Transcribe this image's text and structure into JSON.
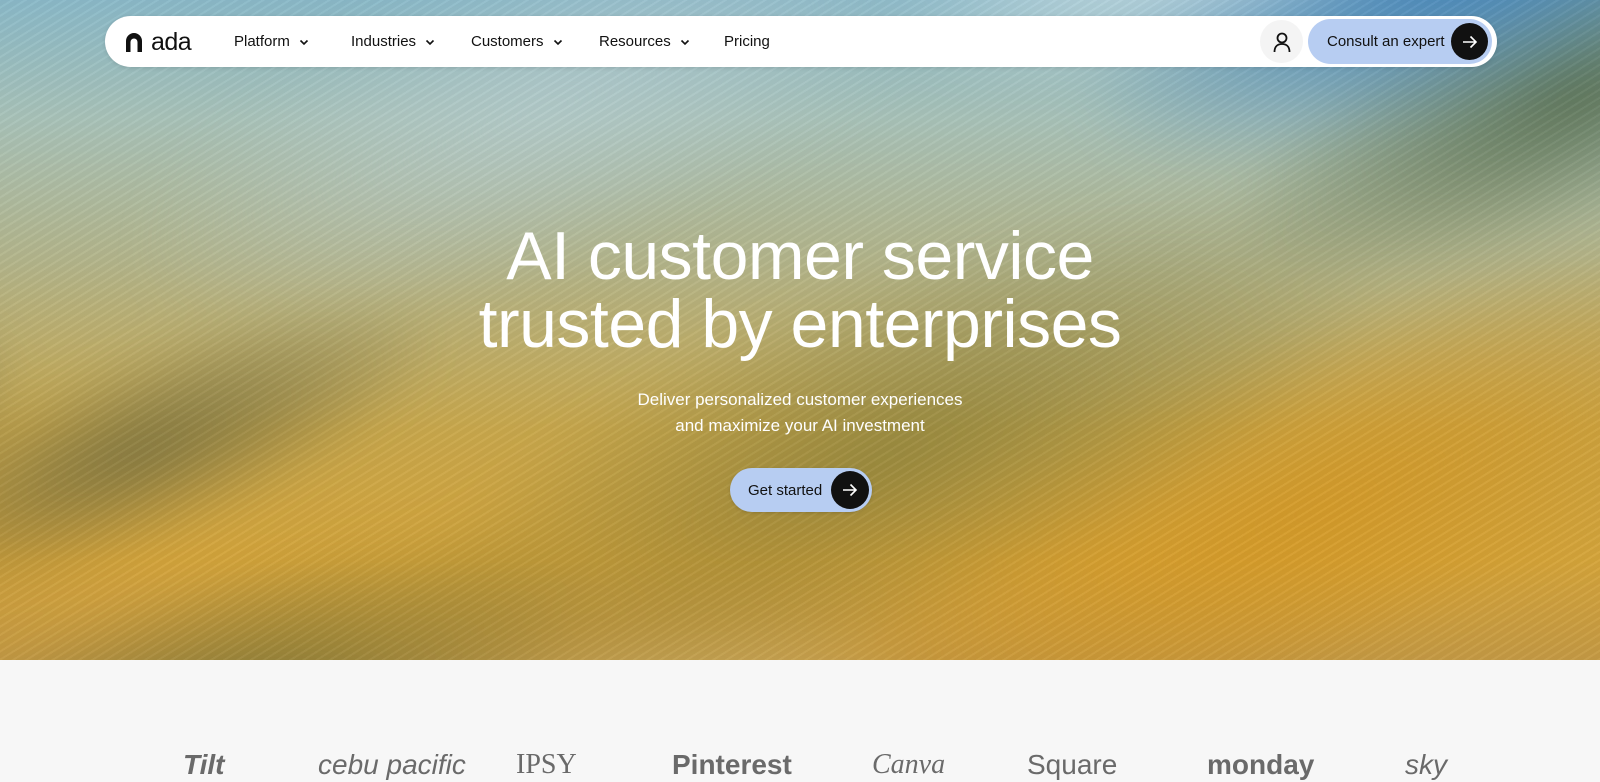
{
  "nav": {
    "logo_text": "ada",
    "items": [
      {
        "label": "Platform",
        "has_dropdown": true
      },
      {
        "label": "Industries",
        "has_dropdown": true
      },
      {
        "label": "Customers",
        "has_dropdown": true
      },
      {
        "label": "Resources",
        "has_dropdown": true
      },
      {
        "label": "Pricing",
        "has_dropdown": false
      }
    ],
    "account_icon": "user-icon",
    "cta_label": "Consult an expert",
    "cta_icon": "arrow-right-icon"
  },
  "hero": {
    "headline_line1": "AI customer service",
    "headline_line2": "trusted by enterprises",
    "subhead_line1": "Deliver personalized customer experiences",
    "subhead_line2": "and maximize your AI investment",
    "cta_label": "Get started",
    "cta_icon": "arrow-right-icon"
  },
  "logos": [
    "Tilt",
    "cebu pacific",
    "IPSY",
    "Pinterest",
    "Canva",
    "Square",
    "monday",
    "sky"
  ],
  "colors": {
    "cta_bg": "#b7cdf2",
    "cta_arrow_bg": "#111111",
    "nav_bg": "#ffffff",
    "logo_strip_bg": "#f7f7f7"
  }
}
